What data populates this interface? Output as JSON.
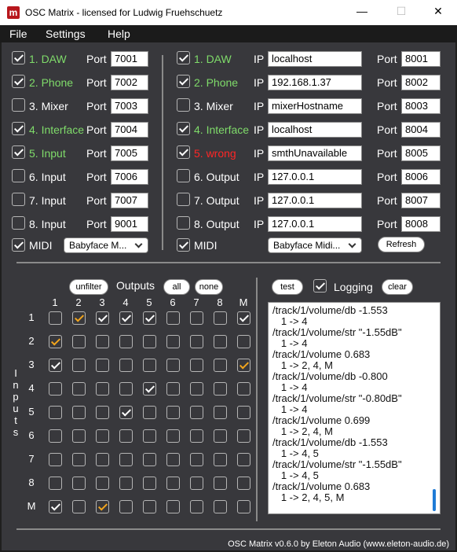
{
  "window": {
    "title": "OSC Matrix - licensed for Ludwig Fruehschuetz",
    "app_icon_letter": "m",
    "minimize_glyph": "—",
    "maximize_glyph": "☐",
    "close_glyph": "✕"
  },
  "menu": [
    "File",
    "Settings",
    "Help"
  ],
  "inputs": [
    {
      "checked": true,
      "name": "1. DAW",
      "color": "green",
      "port_label": "Port",
      "port": "7001"
    },
    {
      "checked": true,
      "name": "2. Phone",
      "color": "green",
      "port_label": "Port",
      "port": "7002"
    },
    {
      "checked": false,
      "name": "3. Mixer",
      "color": "white",
      "port_label": "Port",
      "port": "7003"
    },
    {
      "checked": true,
      "name": "4. Interface",
      "color": "green",
      "port_label": "Port",
      "port": "7004"
    },
    {
      "checked": true,
      "name": "5. Input",
      "color": "green",
      "port_label": "Port",
      "port": "7005"
    },
    {
      "checked": false,
      "name": "6. Input",
      "color": "white",
      "port_label": "Port",
      "port": "7006"
    },
    {
      "checked": false,
      "name": "7. Input",
      "color": "white",
      "port_label": "Port",
      "port": "7007"
    },
    {
      "checked": false,
      "name": "8. Input",
      "color": "white",
      "port_label": "Port",
      "port": "9001"
    }
  ],
  "input_midi": {
    "checked": true,
    "label": "MIDI",
    "device": "Babyface M..."
  },
  "outputs": [
    {
      "checked": true,
      "name": "1. DAW",
      "color": "green",
      "ip_label": "IP",
      "ip": "localhost",
      "port_label": "Port",
      "port": "8001"
    },
    {
      "checked": true,
      "name": "2. Phone",
      "color": "green",
      "ip_label": "IP",
      "ip": "192.168.1.37",
      "port_label": "Port",
      "port": "8002"
    },
    {
      "checked": false,
      "name": "3. Mixer",
      "color": "white",
      "ip_label": "IP",
      "ip": "mixerHostname",
      "port_label": "Port",
      "port": "8003"
    },
    {
      "checked": true,
      "name": "4. Interface",
      "color": "green",
      "ip_label": "IP",
      "ip": "localhost",
      "port_label": "Port",
      "port": "8004"
    },
    {
      "checked": true,
      "name": "5. wrong",
      "color": "red",
      "ip_label": "IP",
      "ip": "smthUnavailable",
      "port_label": "Port",
      "port": "8005"
    },
    {
      "checked": false,
      "name": "6. Output",
      "color": "white",
      "ip_label": "IP",
      "ip": "127.0.0.1",
      "port_label": "Port",
      "port": "8006"
    },
    {
      "checked": false,
      "name": "7. Output",
      "color": "white",
      "ip_label": "IP",
      "ip": "127.0.0.1",
      "port_label": "Port",
      "port": "8007"
    },
    {
      "checked": false,
      "name": "8. Output",
      "color": "white",
      "ip_label": "IP",
      "ip": "127.0.0.1",
      "port_label": "Port",
      "port": "8008"
    }
  ],
  "output_midi": {
    "checked": true,
    "label": "MIDI",
    "device": "Babyface Midi..."
  },
  "refresh_label": "Refresh",
  "matrix": {
    "unfilter_label": "unfilter",
    "outputs_label": "Outputs",
    "all_label": "all",
    "none_label": "none",
    "inputs_label": [
      "I",
      "n",
      "p",
      "u",
      "t",
      "s"
    ],
    "col_headers": [
      "1",
      "2",
      "3",
      "4",
      "5",
      "6",
      "7",
      "8",
      "M"
    ],
    "row_headers": [
      "1",
      "2",
      "3",
      "4",
      "5",
      "6",
      "7",
      "8",
      "M"
    ],
    "cells": [
      [
        "empty",
        "orange",
        "white",
        "white",
        "white",
        "empty",
        "empty",
        "empty",
        "white"
      ],
      [
        "orange",
        "empty",
        "empty",
        "empty",
        "empty",
        "empty",
        "empty",
        "empty",
        "empty"
      ],
      [
        "white",
        "empty",
        "empty",
        "empty",
        "empty",
        "empty",
        "empty",
        "empty",
        "orange"
      ],
      [
        "empty",
        "empty",
        "empty",
        "empty",
        "white",
        "empty",
        "empty",
        "empty",
        "empty"
      ],
      [
        "empty",
        "empty",
        "empty",
        "white",
        "empty",
        "empty",
        "empty",
        "empty",
        "empty"
      ],
      [
        "empty",
        "empty",
        "empty",
        "empty",
        "empty",
        "empty",
        "empty",
        "empty",
        "empty"
      ],
      [
        "empty",
        "empty",
        "empty",
        "empty",
        "empty",
        "empty",
        "empty",
        "empty",
        "empty"
      ],
      [
        "empty",
        "empty",
        "empty",
        "empty",
        "empty",
        "empty",
        "empty",
        "empty",
        "empty"
      ],
      [
        "white",
        "empty",
        "orange",
        "empty",
        "empty",
        "empty",
        "empty",
        "empty",
        "empty"
      ]
    ]
  },
  "log": {
    "test_label": "test",
    "logging_checked": true,
    "logging_label": "Logging",
    "clear_label": "clear",
    "lines": [
      "/track/1/volume/db -1.553",
      "   1 -> 4",
      "/track/1/volume/str \"-1.55dB\"",
      "   1 -> 4",
      "/track/1/volume 0.683",
      "   1 -> 2, 4, M",
      "/track/1/volume/db -0.800",
      "   1 -> 4",
      "/track/1/volume/str \"-0.80dB\"",
      "   1 -> 4",
      "/track/1/volume 0.699",
      "   1 -> 2, 4, M",
      "/track/1/volume/db -1.553",
      "   1 -> 4, 5",
      "/track/1/volume/str \"-1.55dB\"",
      "   1 -> 4, 5",
      "/track/1/volume 0.683",
      "   1 -> 2, 4, 5, M"
    ]
  },
  "footer": "OSC Matrix v0.6.0 by Eleton Audio (www.eleton-audio.de)"
}
